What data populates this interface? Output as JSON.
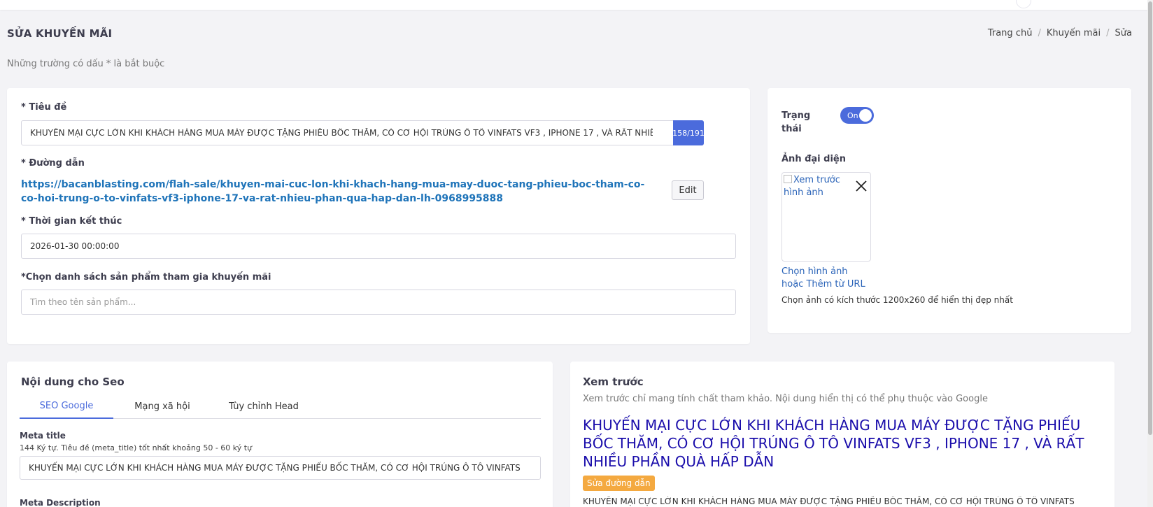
{
  "page": {
    "title": "SỬA KHUYẾN MÃI",
    "required_note": "Những trường có dấu * là bắt buộc",
    "breadcrumb": [
      "Trang chủ",
      "Khuyến mãi",
      "Sửa"
    ]
  },
  "form": {
    "title_label": "* Tiêu đề",
    "title_value": "KHUYẾN MẠI CỰC LỚN KHI KHÁCH HÀNG MUA MÁY ĐƯỢC TẶNG PHIẾU BỐC THĂM, CÓ CƠ HỘI TRÚNG Ô TÔ VINFATS VF3 , IPHONE 17 , VÀ RẤT NHIỀU PHẦN",
    "title_counter": "158/191",
    "slug_label": "* Đường dẫn",
    "slug_line1": "https://bacanblasting.com/flah-sale/khuyen-mai-cuc-lon-khi-khach-hang-mua-may-duoc-tang-phieu-boc-tham-co-",
    "slug_line2": "co-hoi-trung-o-to-vinfats-vf3-iphone-17-va-rat-nhieu-phan-qua-hap-dan-lh-0968995888",
    "edit_label": "Edit",
    "end_time_label": "* Thời gian kết thúc",
    "end_time_value": "2026-01-30 00:00:00",
    "products_label": "*Chọn danh sách sản phẩm tham gia khuyến mãi",
    "products_placeholder": "Tìm theo tên sản phẩm..."
  },
  "side": {
    "status_label": "Trạng thái",
    "toggle_label": "On",
    "avatar_label": "Ảnh đại diện",
    "image_alt": "Xem trước hình ảnh",
    "choose_image": "Chọn hình ảnh",
    "or_text": "hoặc",
    "add_from_url": "Thêm từ URL",
    "size_hint": "Chọn ảnh có kích thước 1200x260 để hiển thị đẹp nhất"
  },
  "seo": {
    "title": "Nội dung cho Seo",
    "tabs": [
      "SEO Google",
      "Mạng xã hội",
      "Tùy chỉnh Head"
    ],
    "meta_title_label": "Meta title",
    "meta_title_note": "144 Ký tự. Tiêu đề (meta_title) tốt nhất khoảng 50 - 60 ký tự",
    "meta_title_value": "KHUYẾN MẠI CỰC LỚN KHI KHÁCH HÀNG MUA MÁY ĐƯỢC TẶNG PHIẾU BỐC THĂM, CÓ CƠ HỘI TRÚNG Ô TÔ VINFATS",
    "meta_desc_label": "Meta Description"
  },
  "preview": {
    "title": "Xem trước",
    "note": "Xem trước chỉ mang tính chất tham khảo. Nội dung hiển thị có thể phụ thuộc vào Google",
    "headline": "KHUYẾN MẠI CỰC LỚN KHI KHÁCH HÀNG MUA MÁY ĐƯỢC TẶNG PHIẾU BỐC THĂM, CÓ CƠ HỘI TRÚNG Ô TÔ VINFATS VF3 , IPHONE 17 , VÀ RẤT NHIỀU PHẦN QUÀ HẤP DẪN",
    "edit_slug_badge": "Sửa đường dẫn",
    "description": "KHUYẾN MẠI CỰC LỚN KHI KHÁCH HÀNG MUA MÁY ĐƯỢC TẶNG PHIẾU BỐC THĂM, CÓ CƠ HỘI TRÚNG Ô TÔ VINFATS"
  },
  "colors": {
    "accent": "#4b6bdc",
    "link": "#1f74b9",
    "google_title": "#1a0dab",
    "badge": "#f4a940"
  }
}
